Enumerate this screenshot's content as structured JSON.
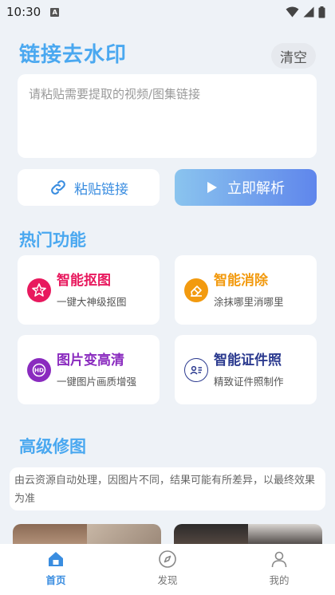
{
  "status": {
    "time": "10:30",
    "notif_letter": "A"
  },
  "header": {
    "title": "链接去水印",
    "clear_label": "清空"
  },
  "input": {
    "placeholder": "请粘贴需要提取的视频/图集链接",
    "value": ""
  },
  "actions": {
    "paste_label": "粘贴链接",
    "parse_label": "立即解析"
  },
  "hot": {
    "title": "热门功能",
    "items": [
      {
        "title": "智能抠图",
        "subtitle": "一键大神级抠图",
        "icon": "cutout-icon",
        "color": "#e8195e"
      },
      {
        "title": "智能消除",
        "subtitle": "涂抹哪里消哪里",
        "icon": "eraser-icon",
        "color": "#f29a0f"
      },
      {
        "title": "图片变高清",
        "subtitle": "一键图片画质增强",
        "icon": "hd-icon",
        "color": "#8a2bbf"
      },
      {
        "title": "智能证件照",
        "subtitle": "精致证件照制作",
        "icon": "id-photo-icon",
        "color": "#2b3a8f"
      }
    ]
  },
  "advanced": {
    "title": "高级修图",
    "notice": "由云资源自动处理，因图片不同，结果可能有所差异，以最终效果为准"
  },
  "tabs": [
    {
      "label": "首页",
      "icon": "home-icon",
      "active": true
    },
    {
      "label": "发现",
      "icon": "compass-icon",
      "active": false
    },
    {
      "label": "我的",
      "icon": "user-icon",
      "active": false
    }
  ],
  "colors": {
    "accent": "#4aa8f0",
    "link": "#3a8de0",
    "background": "#eef2f7"
  }
}
